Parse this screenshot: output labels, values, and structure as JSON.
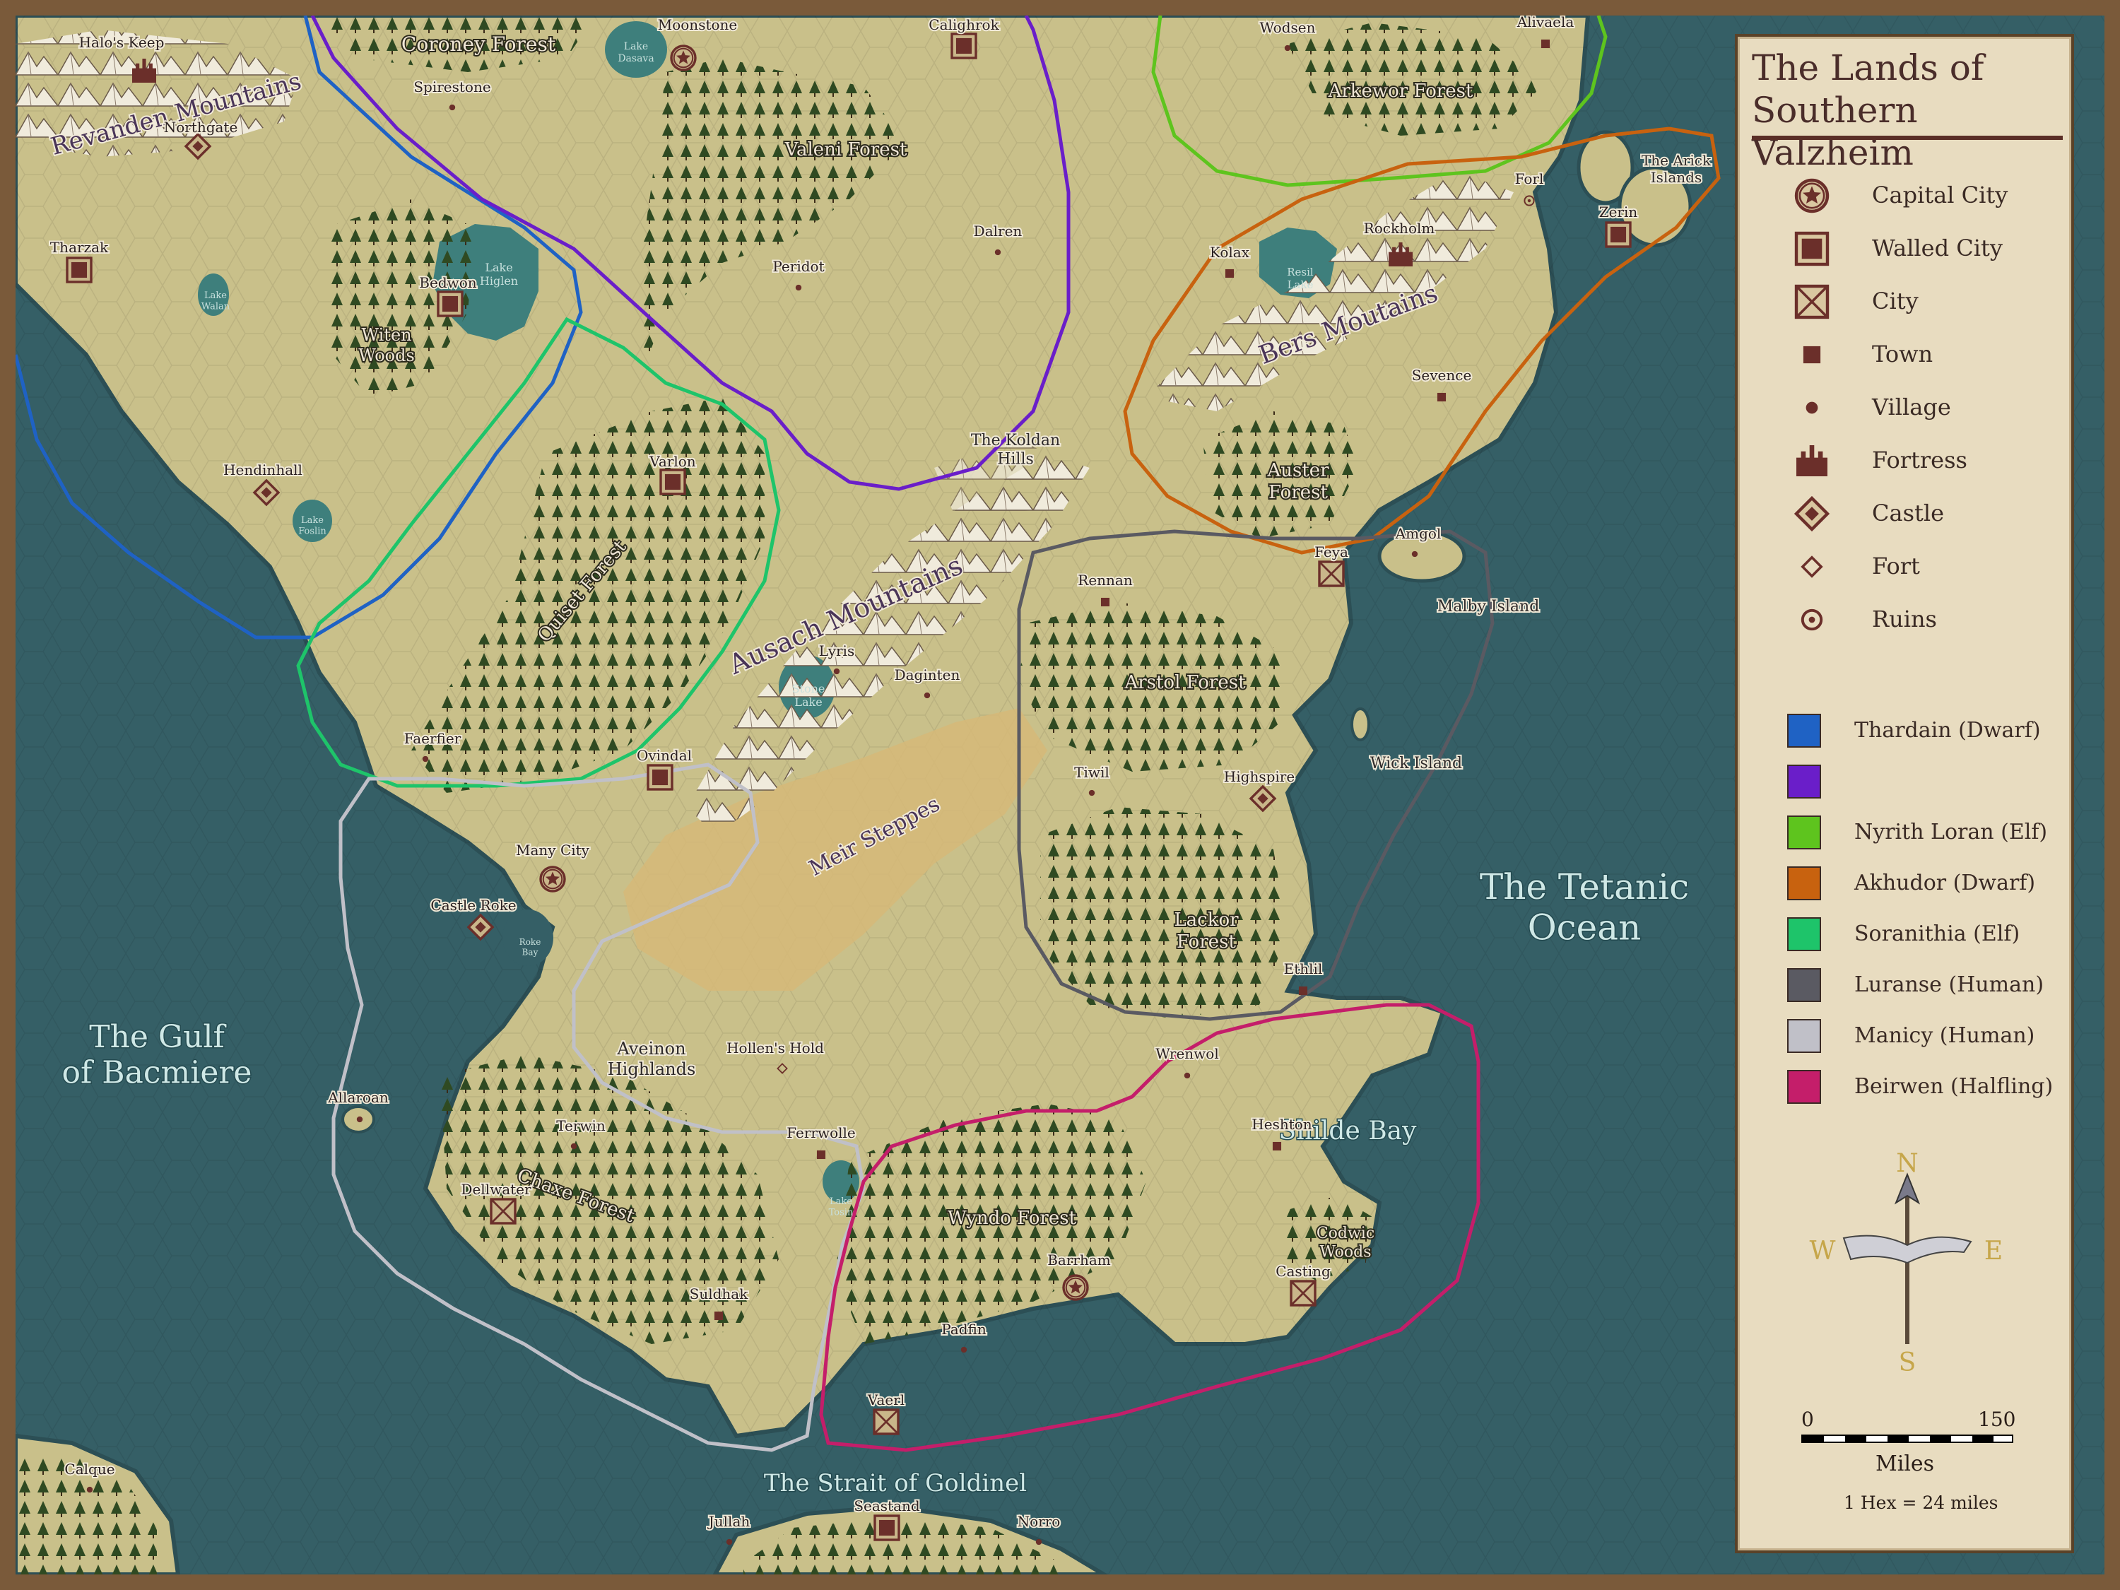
{
  "map": {
    "title": "The Lands of Southern Valzheim",
    "colors": {
      "ocean": "#355f66",
      "land": "#c9c08a",
      "steppe": "#d6b978",
      "lake": "#3e7f7c",
      "forest": "#3f5b2b",
      "mountain": "#e7e0cc",
      "label": "#3a2845",
      "water_label": "#cfe8e6"
    },
    "regions": [
      {
        "name": "The Gulf of Bacmiere",
        "kind": "water"
      },
      {
        "name": "The Tetanic Ocean",
        "kind": "water"
      },
      {
        "name": "The Strait of Goldinel",
        "kind": "water"
      },
      {
        "name": "Shilde Bay",
        "kind": "water"
      },
      {
        "name": "Revanden Mountains",
        "kind": "mountains"
      },
      {
        "name": "Ausach Mountains",
        "kind": "mountains"
      },
      {
        "name": "Bers Moutains",
        "kind": "mountains"
      },
      {
        "name": "The Koldan Hills",
        "kind": "hills"
      },
      {
        "name": "Aveinon Highlands",
        "kind": "hills"
      },
      {
        "name": "Meir Steppes",
        "kind": "plains"
      },
      {
        "name": "Coroney Forest",
        "kind": "forest"
      },
      {
        "name": "Valeni Forest",
        "kind": "forest"
      },
      {
        "name": "Arkewor Forest",
        "kind": "forest"
      },
      {
        "name": "Witen Woods",
        "kind": "forest"
      },
      {
        "name": "Quiset Forest",
        "kind": "forest"
      },
      {
        "name": "Auster Forest",
        "kind": "forest"
      },
      {
        "name": "Arstol Forest",
        "kind": "forest"
      },
      {
        "name": "Lackor Forest",
        "kind": "forest"
      },
      {
        "name": "Chaxe Forest",
        "kind": "forest"
      },
      {
        "name": "Wyndo Forest",
        "kind": "forest"
      },
      {
        "name": "Codwic Woods",
        "kind": "forest"
      },
      {
        "name": "Lake Dasava",
        "kind": "lake"
      },
      {
        "name": "Lake Higlen",
        "kind": "lake"
      },
      {
        "name": "Lake Walan",
        "kind": "lake"
      },
      {
        "name": "Lake Foslin",
        "kind": "lake"
      },
      {
        "name": "Resil Lake",
        "kind": "lake"
      },
      {
        "name": "Stone Lake",
        "kind": "lake"
      },
      {
        "name": "Lake Tosin",
        "kind": "lake"
      },
      {
        "name": "Roke Bay",
        "kind": "water"
      },
      {
        "name": "The Arick Islands",
        "kind": "island"
      },
      {
        "name": "Malby Island",
        "kind": "island"
      },
      {
        "name": "Wick Island",
        "kind": "island"
      }
    ],
    "settlements": [
      {
        "name": "Halo's Keep",
        "type": "Fortress"
      },
      {
        "name": "Northgate",
        "type": "Castle"
      },
      {
        "name": "Tharzak",
        "type": "Walled City"
      },
      {
        "name": "Spirestone",
        "type": "Village"
      },
      {
        "name": "Moonstone",
        "type": "Capital City"
      },
      {
        "name": "Calighrok",
        "type": "Walled City"
      },
      {
        "name": "Wodsen",
        "type": "Village"
      },
      {
        "name": "Alivaela",
        "type": "Town"
      },
      {
        "name": "Bedwon",
        "type": "Walled City"
      },
      {
        "name": "Peridot",
        "type": "Village"
      },
      {
        "name": "Dalren",
        "type": "Village"
      },
      {
        "name": "Forl",
        "type": "Ruins"
      },
      {
        "name": "Zerin",
        "type": "Walled City"
      },
      {
        "name": "Kolax",
        "type": "Town"
      },
      {
        "name": "Rockholm",
        "type": "Fortress"
      },
      {
        "name": "Sevence",
        "type": "Town"
      },
      {
        "name": "Hendinhall",
        "type": "Castle"
      },
      {
        "name": "Varlon",
        "type": "Walled City"
      },
      {
        "name": "Amgol",
        "type": "Village"
      },
      {
        "name": "Feya",
        "type": "City"
      },
      {
        "name": "Rennan",
        "type": "Town"
      },
      {
        "name": "Lyris",
        "type": "Village"
      },
      {
        "name": "Daginten",
        "type": "Village"
      },
      {
        "name": "Faerfier",
        "type": "Village"
      },
      {
        "name": "Ovindal",
        "type": "Walled City"
      },
      {
        "name": "Tiwil",
        "type": "Village"
      },
      {
        "name": "Highspire",
        "type": "Castle"
      },
      {
        "name": "Many City",
        "type": "Capital City"
      },
      {
        "name": "Castle Roke",
        "type": "Castle"
      },
      {
        "name": "Ethlil",
        "type": "Town"
      },
      {
        "name": "Hollen's Hold",
        "type": "Fort"
      },
      {
        "name": "Wrenwol",
        "type": "Village"
      },
      {
        "name": "Allaroan",
        "type": "Village"
      },
      {
        "name": "Terwin",
        "type": "Village"
      },
      {
        "name": "Ferrwolle",
        "type": "Town"
      },
      {
        "name": "Heshton",
        "type": "Town"
      },
      {
        "name": "Dellwater",
        "type": "City"
      },
      {
        "name": "Barrham",
        "type": "Capital City"
      },
      {
        "name": "Casting",
        "type": "City"
      },
      {
        "name": "Suldhak",
        "type": "Town"
      },
      {
        "name": "Padfin",
        "type": "Village"
      },
      {
        "name": "Vaerl",
        "type": "City"
      },
      {
        "name": "Calque",
        "type": "Village"
      },
      {
        "name": "Seastand",
        "type": "Walled City"
      },
      {
        "name": "Jullah",
        "type": "Village"
      },
      {
        "name": "Norro",
        "type": "Village"
      }
    ],
    "legend": {
      "symbols": [
        {
          "label": "Capital City",
          "icon": "capital-city-icon"
        },
        {
          "label": "Walled City",
          "icon": "walled-city-icon"
        },
        {
          "label": "City",
          "icon": "city-icon"
        },
        {
          "label": "Town",
          "icon": "town-icon"
        },
        {
          "label": "Village",
          "icon": "village-icon"
        },
        {
          "label": "Fortress",
          "icon": "fortress-icon"
        },
        {
          "label": "Castle",
          "icon": "castle-icon"
        },
        {
          "label": "Fort",
          "icon": "fort-icon"
        },
        {
          "label": "Ruins",
          "icon": "ruins-icon"
        }
      ],
      "polities": [
        {
          "label": "Thardain (Dwarf)",
          "color": "#1f62c4"
        },
        {
          "label": "",
          "color": "#6a1ec9"
        },
        {
          "label": "Nyrith Loran (Elf)",
          "color": "#5ec41e"
        },
        {
          "label": "Akhudor (Dwarf)",
          "color": "#c8620f"
        },
        {
          "label": "Soranithia (Elf)",
          "color": "#1ec46a"
        },
        {
          "label": "Luranse (Human)",
          "color": "#5a5a62"
        },
        {
          "label": "Manicy (Human)",
          "color": "#c0c0c8"
        },
        {
          "label": "Beirwen (Halfling)",
          "color": "#c41e6a"
        }
      ],
      "compass": {
        "n": "N",
        "s": "S",
        "e": "E",
        "w": "W"
      },
      "scale": {
        "min": "0",
        "max": "150",
        "unit": "Miles",
        "hex_note": "1 Hex = 24 miles"
      }
    }
  }
}
